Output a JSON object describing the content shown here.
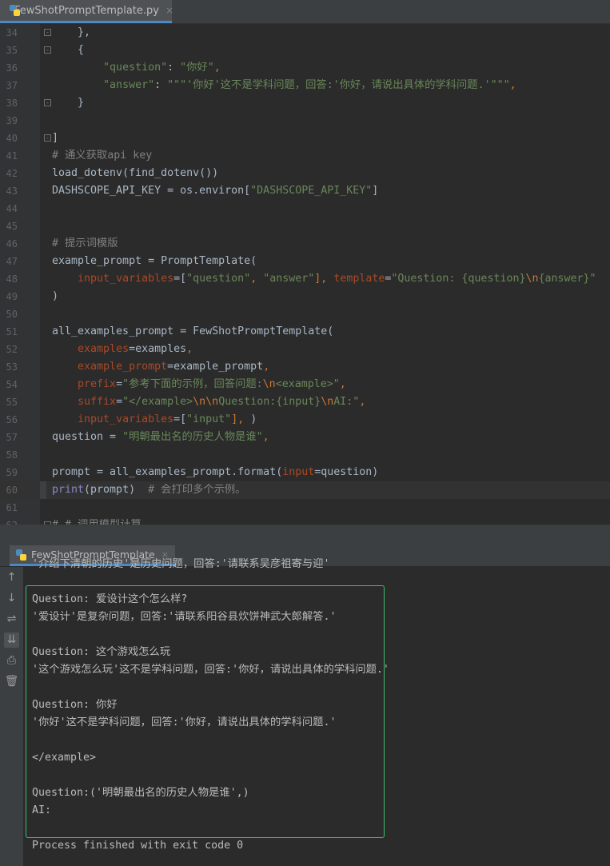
{
  "editor_tab": {
    "filename": "FewShotPromptTemplate.py",
    "close": "×"
  },
  "code_lines": [
    {
      "no": "34",
      "fold": "-",
      "tokens": [
        {
          "t": "    },",
          "c": "def"
        }
      ]
    },
    {
      "no": "35",
      "fold": "-",
      "tokens": [
        {
          "t": "    {",
          "c": "def"
        }
      ]
    },
    {
      "no": "36",
      "fold": "",
      "tokens": [
        {
          "t": "        ",
          "c": "def"
        },
        {
          "t": "\"question\"",
          "c": "str"
        },
        {
          "t": ": ",
          "c": "def"
        },
        {
          "t": "\"你好\"",
          "c": "str"
        },
        {
          "t": ",",
          "c": "key"
        }
      ]
    },
    {
      "no": "37",
      "fold": "",
      "tokens": [
        {
          "t": "        ",
          "c": "def"
        },
        {
          "t": "\"answer\"",
          "c": "str"
        },
        {
          "t": ": ",
          "c": "def"
        },
        {
          "t": "\"\"\"'你好'这不是学科问题，回答:'你好，请说出具体的学科问题.'\"\"\"",
          "c": "str"
        },
        {
          "t": ",",
          "c": "key"
        }
      ]
    },
    {
      "no": "38",
      "fold": "-",
      "tokens": [
        {
          "t": "    }",
          "c": "def"
        }
      ]
    },
    {
      "no": "39",
      "fold": "",
      "tokens": []
    },
    {
      "no": "40",
      "fold": "-",
      "tokens": [
        {
          "t": "]",
          "c": "def"
        }
      ]
    },
    {
      "no": "41",
      "fold": "",
      "tokens": [
        {
          "t": "# 通义获取api key",
          "c": "cmt"
        }
      ]
    },
    {
      "no": "42",
      "fold": "",
      "tokens": [
        {
          "t": "load_dotenv(find_dotenv())",
          "c": "def"
        }
      ]
    },
    {
      "no": "43",
      "fold": "",
      "tokens": [
        {
          "t": "DASHSCOPE_API_KEY = os.environ[",
          "c": "def"
        },
        {
          "t": "\"DASHSCOPE_API_KEY\"",
          "c": "str"
        },
        {
          "t": "]",
          "c": "def"
        }
      ]
    },
    {
      "no": "44",
      "fold": "",
      "tokens": []
    },
    {
      "no": "45",
      "fold": "",
      "tokens": []
    },
    {
      "no": "46",
      "fold": "",
      "tokens": [
        {
          "t": "# 提示词模版",
          "c": "cmt"
        }
      ]
    },
    {
      "no": "47",
      "fold": "",
      "tokens": [
        {
          "t": "example_prompt = PromptTemplate(",
          "c": "def"
        }
      ]
    },
    {
      "no": "48",
      "fold": "",
      "tokens": [
        {
          "t": "    ",
          "c": "def"
        },
        {
          "t": "input_variables",
          "c": "arg"
        },
        {
          "t": "=[",
          "c": "def"
        },
        {
          "t": "\"question\"",
          "c": "str"
        },
        {
          "t": ", ",
          "c": "key"
        },
        {
          "t": "\"answer\"",
          "c": "str"
        },
        {
          "t": "], ",
          "c": "key"
        },
        {
          "t": "template",
          "c": "arg"
        },
        {
          "t": "=",
          "c": "def"
        },
        {
          "t": "\"Question: {question}",
          "c": "str"
        },
        {
          "t": "\\n",
          "c": "esc"
        },
        {
          "t": "{answer}\"",
          "c": "str"
        }
      ]
    },
    {
      "no": "49",
      "fold": "",
      "tokens": [
        {
          "t": ")",
          "c": "def"
        }
      ]
    },
    {
      "no": "50",
      "fold": "",
      "tokens": []
    },
    {
      "no": "51",
      "fold": "",
      "tokens": [
        {
          "t": "all_examples_prompt = FewShotPromptTemplate(",
          "c": "def"
        }
      ]
    },
    {
      "no": "52",
      "fold": "",
      "tokens": [
        {
          "t": "    ",
          "c": "def"
        },
        {
          "t": "examples",
          "c": "arg"
        },
        {
          "t": "=examples",
          "c": "def"
        },
        {
          "t": ",",
          "c": "key"
        }
      ]
    },
    {
      "no": "53",
      "fold": "",
      "tokens": [
        {
          "t": "    ",
          "c": "def"
        },
        {
          "t": "example_prompt",
          "c": "arg"
        },
        {
          "t": "=example_prompt",
          "c": "def"
        },
        {
          "t": ",",
          "c": "key"
        }
      ]
    },
    {
      "no": "54",
      "fold": "",
      "tokens": [
        {
          "t": "    ",
          "c": "def"
        },
        {
          "t": "prefix",
          "c": "arg"
        },
        {
          "t": "=",
          "c": "def"
        },
        {
          "t": "\"参考下面的示例，回答问题:",
          "c": "str"
        },
        {
          "t": "\\n",
          "c": "esc"
        },
        {
          "t": "<example>\"",
          "c": "str"
        },
        {
          "t": ",",
          "c": "key"
        }
      ]
    },
    {
      "no": "55",
      "fold": "",
      "tokens": [
        {
          "t": "    ",
          "c": "def"
        },
        {
          "t": "suffix",
          "c": "arg"
        },
        {
          "t": "=",
          "c": "def"
        },
        {
          "t": "\"</example>",
          "c": "str"
        },
        {
          "t": "\\n\\n",
          "c": "esc"
        },
        {
          "t": "Question:{input}",
          "c": "str"
        },
        {
          "t": "\\n",
          "c": "esc"
        },
        {
          "t": "AI:\"",
          "c": "str"
        },
        {
          "t": ",",
          "c": "key"
        }
      ]
    },
    {
      "no": "56",
      "fold": "",
      "tokens": [
        {
          "t": "    ",
          "c": "def"
        },
        {
          "t": "input_variables",
          "c": "arg"
        },
        {
          "t": "=[",
          "c": "def"
        },
        {
          "t": "\"input\"",
          "c": "str"
        },
        {
          "t": "], ",
          "c": "key"
        },
        {
          "t": ")",
          "c": "def"
        }
      ]
    },
    {
      "no": "57",
      "fold": "",
      "tokens": [
        {
          "t": "question = ",
          "c": "def"
        },
        {
          "t": "\"明朝最出名的历史人物是谁\"",
          "c": "str"
        },
        {
          "t": ",",
          "c": "key"
        }
      ]
    },
    {
      "no": "58",
      "fold": "",
      "tokens": []
    },
    {
      "no": "59",
      "fold": "",
      "tokens": [
        {
          "t": "prompt = all_examples_prompt.format(",
          "c": "def"
        },
        {
          "t": "input",
          "c": "arg"
        },
        {
          "t": "=question)",
          "c": "def"
        }
      ]
    },
    {
      "no": "60",
      "fold": "",
      "current": true,
      "tokens": [
        {
          "t": "print",
          "c": "fn"
        },
        {
          "t": "(prompt)  ",
          "c": "def"
        },
        {
          "t": "# 会打印多个示例。",
          "c": "cmt"
        }
      ]
    },
    {
      "no": "61",
      "fold": "",
      "tokens": []
    },
    {
      "no": "62",
      "fold": "-",
      "tokens": [
        {
          "t": "# # 调用模型计算",
          "c": "cmt"
        }
      ]
    }
  ],
  "run_tab": {
    "name": "FewShotPromptTemplate",
    "close": "×"
  },
  "console_tools": [
    {
      "name": "up-arrow-icon",
      "glyph": "↑"
    },
    {
      "name": "down-arrow-icon",
      "glyph": "↓"
    },
    {
      "name": "soft-wrap-icon",
      "glyph": "⇌"
    },
    {
      "name": "scroll-to-end-icon",
      "glyph": "⇊"
    },
    {
      "name": "print-icon",
      "glyph": "⎙"
    },
    {
      "name": "trash-icon",
      "glyph": "🗑"
    }
  ],
  "console_output": [
    "'介绍下清朝的历史'是历史问题，回答:'请联系吴彦祖寄与迎'",
    "",
    "Question: 爱设计这个怎么样?",
    "'爱设计'是复杂问题，回答:'请联系阳谷县炊饼神武大郎解答.'",
    "",
    "Question: 这个游戏怎么玩",
    "'这个游戏怎么玩'这不是学科问题，回答:'你好，请说出具体的学科问题.'",
    "",
    "Question: 你好",
    "'你好'这不是学科问题，回答:'你好，请说出具体的学科问题.'",
    "",
    "</example>",
    "",
    "Question:('明朝最出名的历史人物是谁',)",
    "AI:",
    "",
    "Process finished with exit code 0"
  ],
  "colors": {
    "accent": "#4a88c7",
    "frame": "#3fbf6e",
    "string": "#6a8759",
    "keyword": "#cc7832",
    "comment": "#808080",
    "param": "#aa4926"
  }
}
